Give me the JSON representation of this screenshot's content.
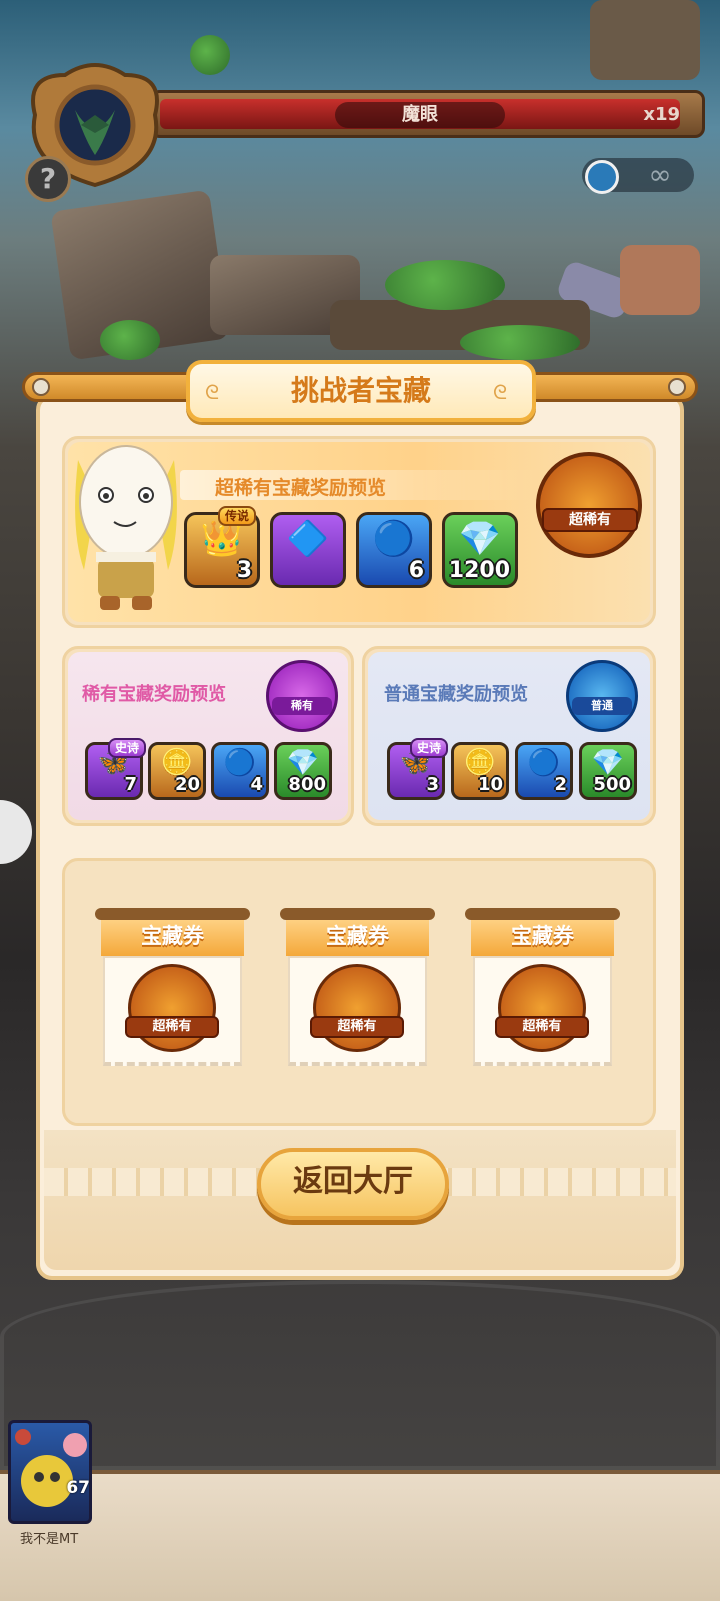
{
  "boss": {
    "name": "魔眼",
    "count": "x19",
    "timer": "∞"
  },
  "panel": {
    "title": "挑战者宝藏",
    "super_rare": {
      "label": "超稀有宝藏奖励预览",
      "seal_label": "超稀有",
      "items": [
        {
          "icon": "gold-relic-icon",
          "tag": "传说",
          "count": "3"
        },
        {
          "icon": "purple-rune-icon",
          "tag": "",
          "count": ""
        },
        {
          "icon": "blue-orb-icon",
          "tag": "",
          "count": "6"
        },
        {
          "icon": "diamond-pile-icon",
          "tag": "",
          "count": "1200"
        }
      ]
    },
    "rare": {
      "label": "稀有宝藏奖励预览",
      "seal_label": "稀有",
      "items": [
        {
          "icon": "purple-relic-icon",
          "tag": "史诗",
          "count": "7"
        },
        {
          "icon": "gold-coins-icon",
          "tag": "",
          "count": "20"
        },
        {
          "icon": "blue-orb-icon",
          "tag": "",
          "count": "4"
        },
        {
          "icon": "diamond-pile-icon",
          "tag": "",
          "count": "800"
        }
      ]
    },
    "common": {
      "label": "普通宝藏奖励预览",
      "seal_label": "普通",
      "items": [
        {
          "icon": "purple-relic-icon",
          "tag": "史诗",
          "count": "3"
        },
        {
          "icon": "gold-coins-icon",
          "tag": "",
          "count": "10"
        },
        {
          "icon": "blue-orb-icon",
          "tag": "",
          "count": "2"
        },
        {
          "icon": "diamond-pile-icon",
          "tag": "",
          "count": "500"
        }
      ]
    },
    "tickets": [
      {
        "label": "宝藏券",
        "seal_label": "超稀有"
      },
      {
        "label": "宝藏券",
        "seal_label": "超稀有"
      },
      {
        "label": "宝藏券",
        "seal_label": "超稀有"
      }
    ],
    "back_button": "返回大厅"
  },
  "player": {
    "level": "67",
    "name": "我不是MT"
  },
  "colors": {
    "accent": "#f2b13c",
    "title": "#d57a1a",
    "super_label": "#e58a2a",
    "rare_label": "#e05aa6",
    "common_label": "#5a7ab8"
  }
}
